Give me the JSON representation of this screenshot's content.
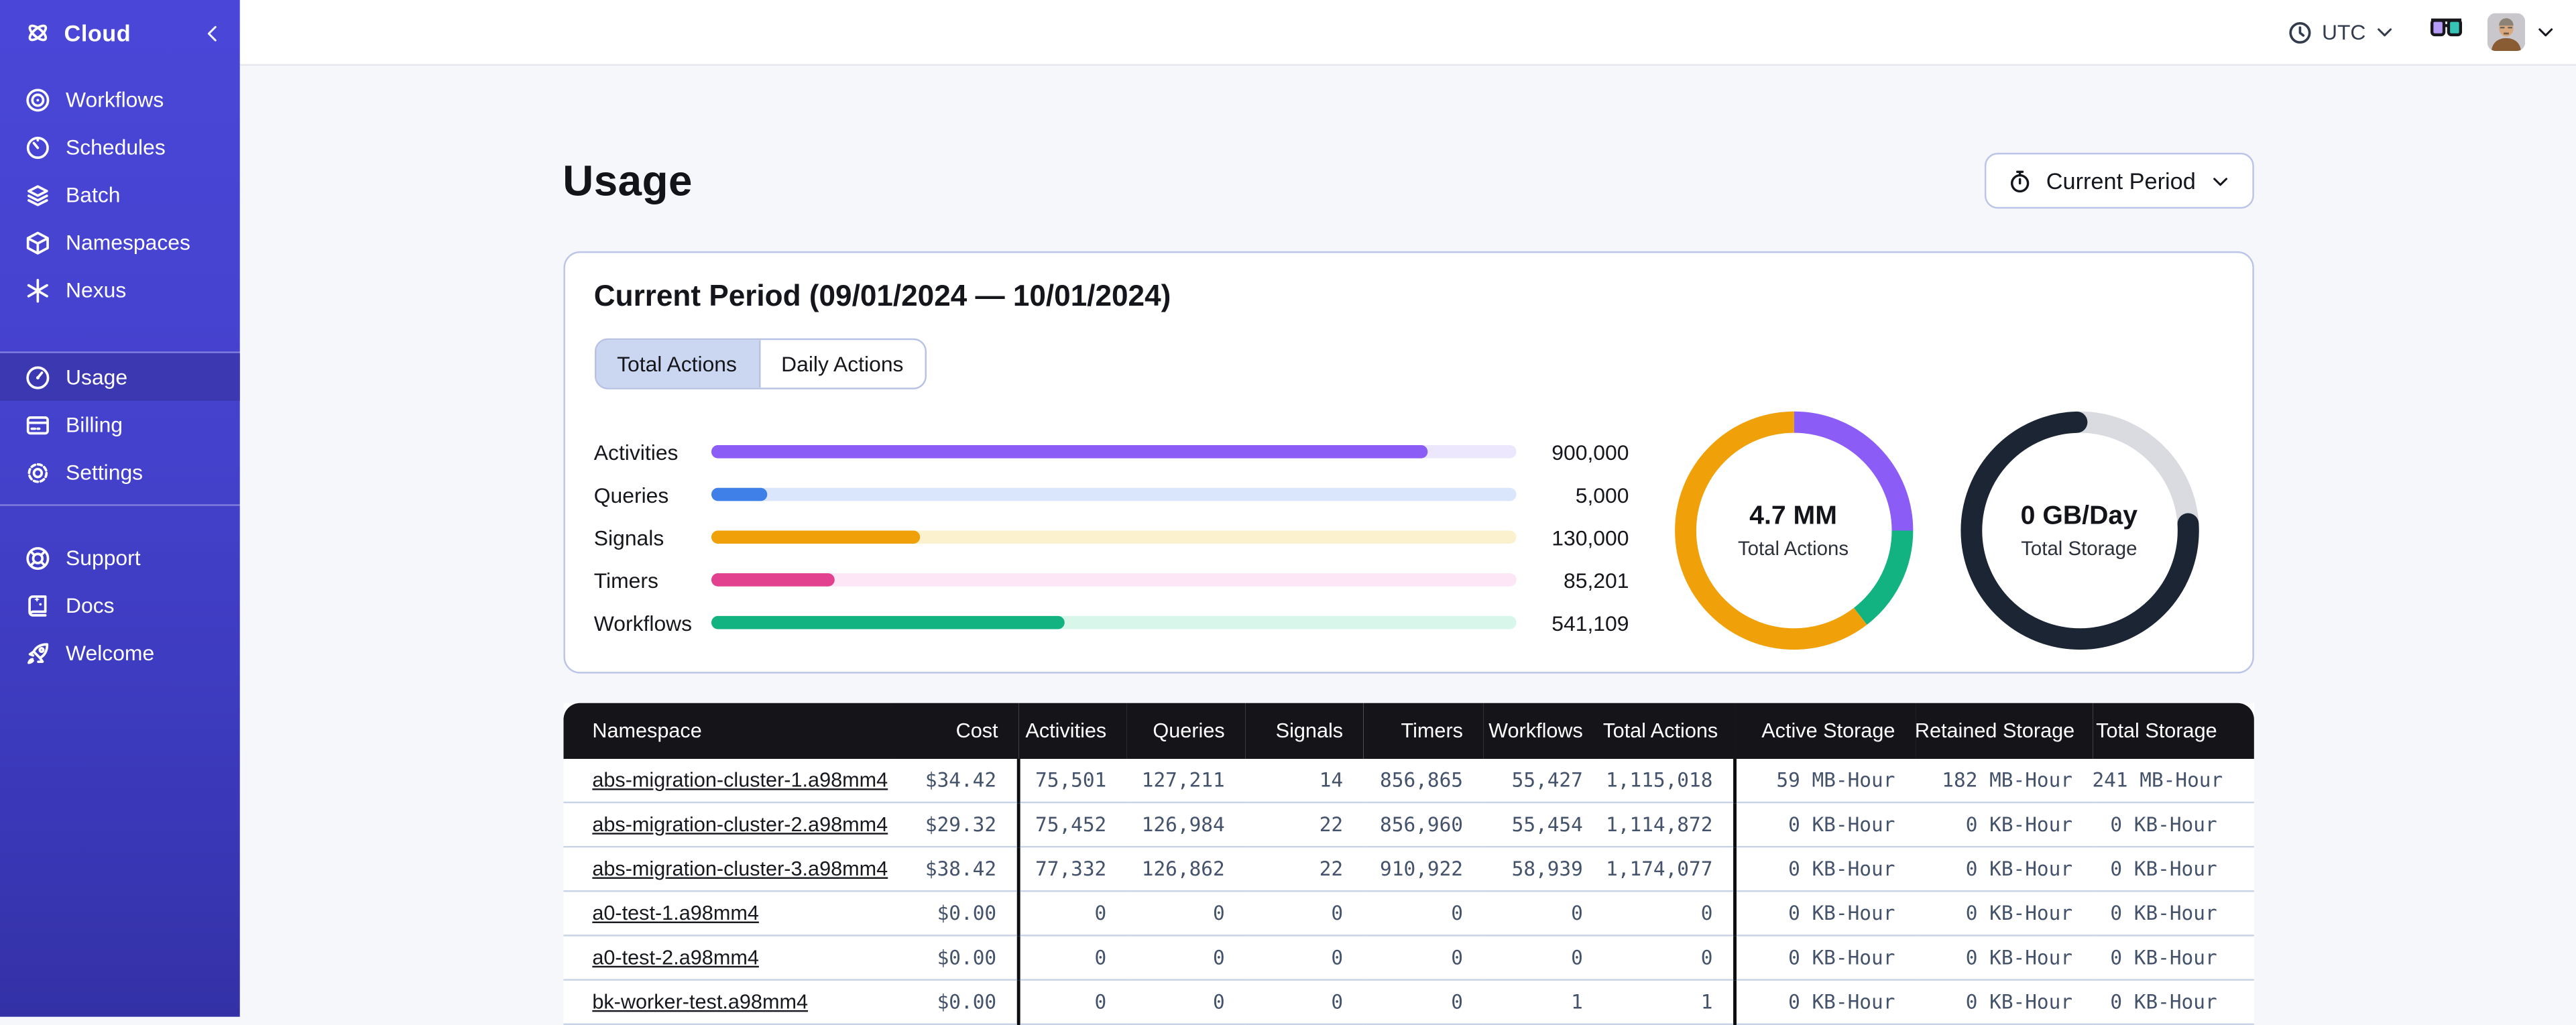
{
  "sidebar": {
    "brand": {
      "label": "Cloud",
      "icon": "temporal-logo-icon",
      "collapse_icon": "chevron-left-icon"
    },
    "sections": [
      {
        "items": [
          {
            "label": "Workflows",
            "icon": "workflows-icon",
            "active": false
          },
          {
            "label": "Schedules",
            "icon": "schedules-icon",
            "active": false
          },
          {
            "label": "Batch",
            "icon": "batch-icon",
            "active": false
          },
          {
            "label": "Namespaces",
            "icon": "namespaces-icon",
            "active": false
          },
          {
            "label": "Nexus",
            "icon": "nexus-icon",
            "active": false
          }
        ]
      },
      {
        "items": [
          {
            "label": "Usage",
            "icon": "usage-icon",
            "active": true
          },
          {
            "label": "Billing",
            "icon": "billing-icon",
            "active": false
          },
          {
            "label": "Settings",
            "icon": "settings-icon",
            "active": false
          }
        ]
      },
      {
        "items": [
          {
            "label": "Support",
            "icon": "support-icon",
            "active": false
          },
          {
            "label": "Docs",
            "icon": "docs-icon",
            "active": false
          },
          {
            "label": "Welcome",
            "icon": "welcome-icon",
            "active": false
          }
        ]
      }
    ]
  },
  "topbar": {
    "timezone": {
      "label": "UTC",
      "icon": "clock-icon",
      "chevron": "chevron-down-icon"
    },
    "glasses": {
      "icon": "glasses-icon"
    },
    "account": {
      "avatar": "user-avatar",
      "chevron": "chevron-down-icon"
    }
  },
  "page": {
    "title": "Usage",
    "period_button": {
      "label": "Current Period",
      "icon": "stopwatch-icon",
      "chevron": "chevron-down-icon"
    }
  },
  "usage_card": {
    "heading": "Current Period (09/01/2024 — 10/01/2024)",
    "tabs": [
      {
        "label": "Total Actions",
        "active": true
      },
      {
        "label": "Daily Actions",
        "active": false
      }
    ],
    "chart_data": {
      "type": "bar",
      "categories": [
        "Activities",
        "Queries",
        "Signals",
        "Timers",
        "Workflows"
      ],
      "values": [
        900000,
        5000,
        130000,
        85201,
        541109
      ],
      "display_values": [
        "900,000",
        "5,000",
        "130,000",
        "85,201",
        "541,109"
      ],
      "fill_pct": [
        89,
        7,
        26,
        15.5,
        44
      ],
      "colors": [
        "#8b5cf6",
        "#3f7fe8",
        "#f0a009",
        "#e2418f",
        "#12b380"
      ],
      "track_colors": [
        "#ece7fd",
        "#d9e6fb",
        "#fcf1cf",
        "#fde6f5",
        "#d8f7ea"
      ]
    },
    "donuts": [
      {
        "value": "4.7 MM",
        "label": "Total Actions",
        "cap": "butt",
        "track_color": null,
        "segments": [
          {
            "color": "#8b5cf6",
            "pct": 25,
            "start": 0
          },
          {
            "color": "#12b380",
            "pct": 14.5,
            "start": 25
          },
          {
            "color": "#f0a009",
            "pct": 60.5,
            "start": 39.5
          }
        ]
      },
      {
        "value": "0 GB/Day",
        "label": "Total Storage",
        "cap": "round",
        "track_color": "#d9dbe0",
        "segments": [
          {
            "color": "#1c2534",
            "pct": 75.5,
            "start": 24
          }
        ]
      }
    ]
  },
  "table": {
    "columns": [
      {
        "label": "Namespace"
      },
      {
        "label": "Cost"
      },
      {
        "label": "Activities"
      },
      {
        "label": "Queries"
      },
      {
        "label": "Signals"
      },
      {
        "label": "Timers"
      },
      {
        "label": "Workflows"
      },
      {
        "label": "Total Actions"
      },
      {
        "label": "Active Storage"
      },
      {
        "label": "Retained Storage"
      },
      {
        "label": "Total Storage"
      }
    ],
    "rows": [
      {
        "cells": [
          "abs-migration-cluster-1.a98mm4",
          "$34.42",
          "75,501",
          "127,211",
          "14",
          "856,865",
          "55,427",
          "1,115,018",
          "59 MB-Hour",
          "182 MB-Hour",
          "241 MB-Hour"
        ]
      },
      {
        "cells": [
          "abs-migration-cluster-2.a98mm4",
          "$29.32",
          "75,452",
          "126,984",
          "22",
          "856,960",
          "55,454",
          "1,114,872",
          "0 KB-Hour",
          "0 KB-Hour",
          "0 KB-Hour"
        ]
      },
      {
        "cells": [
          "abs-migration-cluster-3.a98mm4",
          "$38.42",
          "77,332",
          "126,862",
          "22",
          "910,922",
          "58,939",
          "1,174,077",
          "0 KB-Hour",
          "0 KB-Hour",
          "0 KB-Hour"
        ]
      },
      {
        "cells": [
          "a0-test-1.a98mm4",
          "$0.00",
          "0",
          "0",
          "0",
          "0",
          "0",
          "0",
          "0 KB-Hour",
          "0 KB-Hour",
          "0 KB-Hour"
        ]
      },
      {
        "cells": [
          "a0-test-2.a98mm4",
          "$0.00",
          "0",
          "0",
          "0",
          "0",
          "0",
          "0",
          "0 KB-Hour",
          "0 KB-Hour",
          "0 KB-Hour"
        ]
      },
      {
        "cells": [
          "bk-worker-test.a98mm4",
          "$0.00",
          "0",
          "0",
          "0",
          "0",
          "1",
          "1",
          "0 KB-Hour",
          "0 KB-Hour",
          "0 KB-Hour"
        ]
      }
    ]
  },
  "colors": {
    "sidebar_top": "#4a47d8",
    "sidebar_bottom": "#3431a6",
    "sidebar_active": "#3c38b2",
    "card_border": "#bcc5e9",
    "tab_active_bg": "#cbd7f0",
    "table_header_bg": "#141419",
    "number_text": "#44536b",
    "donut_navy": "#1c2534",
    "donut_track": "#d9dbe0"
  }
}
